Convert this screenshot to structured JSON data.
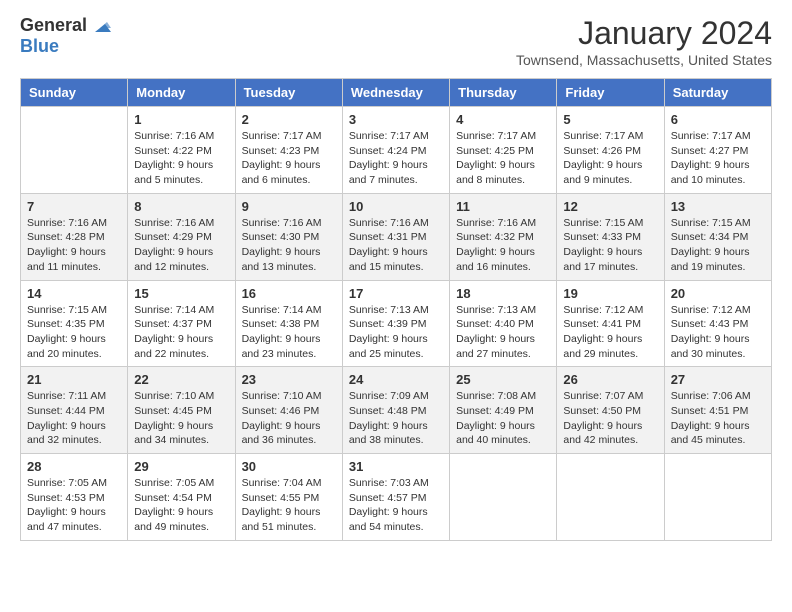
{
  "header": {
    "logo_general": "General",
    "logo_blue": "Blue",
    "month_title": "January 2024",
    "location": "Townsend, Massachusetts, United States"
  },
  "days_of_week": [
    "Sunday",
    "Monday",
    "Tuesday",
    "Wednesday",
    "Thursday",
    "Friday",
    "Saturday"
  ],
  "weeks": [
    [
      {
        "day": "",
        "content": ""
      },
      {
        "day": "1",
        "content": "Sunrise: 7:16 AM\nSunset: 4:22 PM\nDaylight: 9 hours\nand 5 minutes."
      },
      {
        "day": "2",
        "content": "Sunrise: 7:17 AM\nSunset: 4:23 PM\nDaylight: 9 hours\nand 6 minutes."
      },
      {
        "day": "3",
        "content": "Sunrise: 7:17 AM\nSunset: 4:24 PM\nDaylight: 9 hours\nand 7 minutes."
      },
      {
        "day": "4",
        "content": "Sunrise: 7:17 AM\nSunset: 4:25 PM\nDaylight: 9 hours\nand 8 minutes."
      },
      {
        "day": "5",
        "content": "Sunrise: 7:17 AM\nSunset: 4:26 PM\nDaylight: 9 hours\nand 9 minutes."
      },
      {
        "day": "6",
        "content": "Sunrise: 7:17 AM\nSunset: 4:27 PM\nDaylight: 9 hours\nand 10 minutes."
      }
    ],
    [
      {
        "day": "7",
        "content": "Sunrise: 7:16 AM\nSunset: 4:28 PM\nDaylight: 9 hours\nand 11 minutes."
      },
      {
        "day": "8",
        "content": "Sunrise: 7:16 AM\nSunset: 4:29 PM\nDaylight: 9 hours\nand 12 minutes."
      },
      {
        "day": "9",
        "content": "Sunrise: 7:16 AM\nSunset: 4:30 PM\nDaylight: 9 hours\nand 13 minutes."
      },
      {
        "day": "10",
        "content": "Sunrise: 7:16 AM\nSunset: 4:31 PM\nDaylight: 9 hours\nand 15 minutes."
      },
      {
        "day": "11",
        "content": "Sunrise: 7:16 AM\nSunset: 4:32 PM\nDaylight: 9 hours\nand 16 minutes."
      },
      {
        "day": "12",
        "content": "Sunrise: 7:15 AM\nSunset: 4:33 PM\nDaylight: 9 hours\nand 17 minutes."
      },
      {
        "day": "13",
        "content": "Sunrise: 7:15 AM\nSunset: 4:34 PM\nDaylight: 9 hours\nand 19 minutes."
      }
    ],
    [
      {
        "day": "14",
        "content": "Sunrise: 7:15 AM\nSunset: 4:35 PM\nDaylight: 9 hours\nand 20 minutes."
      },
      {
        "day": "15",
        "content": "Sunrise: 7:14 AM\nSunset: 4:37 PM\nDaylight: 9 hours\nand 22 minutes."
      },
      {
        "day": "16",
        "content": "Sunrise: 7:14 AM\nSunset: 4:38 PM\nDaylight: 9 hours\nand 23 minutes."
      },
      {
        "day": "17",
        "content": "Sunrise: 7:13 AM\nSunset: 4:39 PM\nDaylight: 9 hours\nand 25 minutes."
      },
      {
        "day": "18",
        "content": "Sunrise: 7:13 AM\nSunset: 4:40 PM\nDaylight: 9 hours\nand 27 minutes."
      },
      {
        "day": "19",
        "content": "Sunrise: 7:12 AM\nSunset: 4:41 PM\nDaylight: 9 hours\nand 29 minutes."
      },
      {
        "day": "20",
        "content": "Sunrise: 7:12 AM\nSunset: 4:43 PM\nDaylight: 9 hours\nand 30 minutes."
      }
    ],
    [
      {
        "day": "21",
        "content": "Sunrise: 7:11 AM\nSunset: 4:44 PM\nDaylight: 9 hours\nand 32 minutes."
      },
      {
        "day": "22",
        "content": "Sunrise: 7:10 AM\nSunset: 4:45 PM\nDaylight: 9 hours\nand 34 minutes."
      },
      {
        "day": "23",
        "content": "Sunrise: 7:10 AM\nSunset: 4:46 PM\nDaylight: 9 hours\nand 36 minutes."
      },
      {
        "day": "24",
        "content": "Sunrise: 7:09 AM\nSunset: 4:48 PM\nDaylight: 9 hours\nand 38 minutes."
      },
      {
        "day": "25",
        "content": "Sunrise: 7:08 AM\nSunset: 4:49 PM\nDaylight: 9 hours\nand 40 minutes."
      },
      {
        "day": "26",
        "content": "Sunrise: 7:07 AM\nSunset: 4:50 PM\nDaylight: 9 hours\nand 42 minutes."
      },
      {
        "day": "27",
        "content": "Sunrise: 7:06 AM\nSunset: 4:51 PM\nDaylight: 9 hours\nand 45 minutes."
      }
    ],
    [
      {
        "day": "28",
        "content": "Sunrise: 7:05 AM\nSunset: 4:53 PM\nDaylight: 9 hours\nand 47 minutes."
      },
      {
        "day": "29",
        "content": "Sunrise: 7:05 AM\nSunset: 4:54 PM\nDaylight: 9 hours\nand 49 minutes."
      },
      {
        "day": "30",
        "content": "Sunrise: 7:04 AM\nSunset: 4:55 PM\nDaylight: 9 hours\nand 51 minutes."
      },
      {
        "day": "31",
        "content": "Sunrise: 7:03 AM\nSunset: 4:57 PM\nDaylight: 9 hours\nand 54 minutes."
      },
      {
        "day": "",
        "content": ""
      },
      {
        "day": "",
        "content": ""
      },
      {
        "day": "",
        "content": ""
      }
    ]
  ]
}
